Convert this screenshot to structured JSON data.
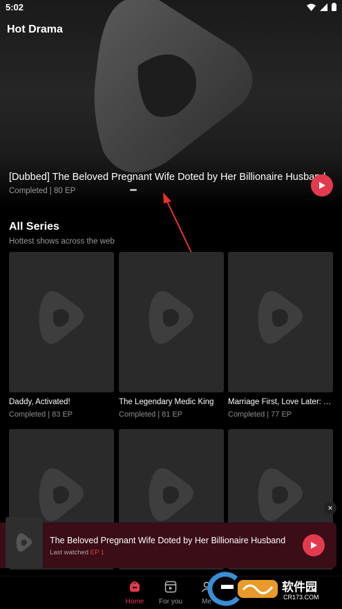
{
  "status_bar": {
    "time": "5:02"
  },
  "hero": {
    "section_title": "Hot Drama",
    "title": "[Dubbed] The Beloved Pregnant Wife Doted by Her Billionaire Husband",
    "subtitle": "Completed | 80 EP"
  },
  "all_series": {
    "title": "All Series",
    "subtitle": "Hottest shows across the web",
    "cards": [
      {
        "title": "Daddy, Activated!",
        "subtitle": "Completed | 83 EP"
      },
      {
        "title": "The Legendary Medic King",
        "subtitle": "Completed | 81 EP"
      },
      {
        "title": "Marriage First, Love Later: The Secret Wife",
        "subtitle": "Completed | 77 EP"
      },
      {
        "title": "",
        "subtitle": ""
      },
      {
        "title": "",
        "subtitle": ""
      },
      {
        "title": "",
        "subtitle": ""
      }
    ]
  },
  "mini_player": {
    "title": "The Beloved Pregnant Wife Doted by Her Billionaire Husband",
    "last_watched": "Last watched",
    "episode": "EP 1",
    "close": "×"
  },
  "nav": {
    "items": [
      {
        "label": "Home",
        "icon": "home-icon"
      },
      {
        "label": "For you",
        "icon": "reels-icon"
      },
      {
        "label": "Me",
        "icon": "profile-icon"
      }
    ]
  },
  "watermark": {
    "text": "软件园",
    "domain": "CR173.COM"
  },
  "colors": {
    "accent": "#e23a4e",
    "background": "#000000",
    "card": "#2a2a2a",
    "mini_player_bg": "#3a0d17"
  }
}
